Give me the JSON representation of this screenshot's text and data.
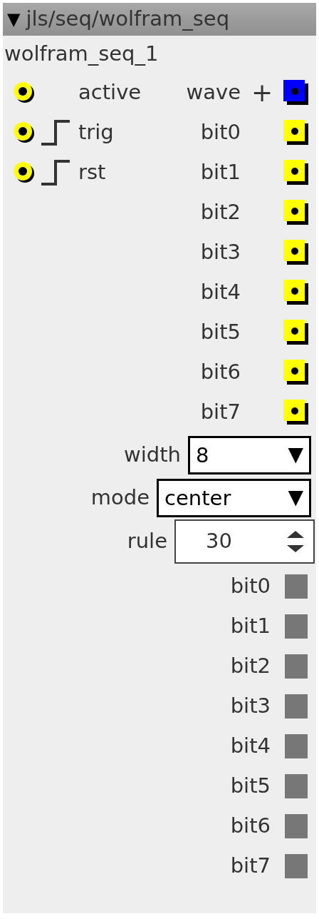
{
  "title_bar": {
    "arrow": "▼",
    "title": "jls/seq/wolfram_seq"
  },
  "node_name": "wolfram_seq_1",
  "inputs": [
    {
      "kind": "value",
      "label": "active"
    },
    {
      "kind": "trigger",
      "label": "trig"
    },
    {
      "kind": "trigger",
      "label": "rst"
    }
  ],
  "outputs": [
    {
      "kind": "wave",
      "label": "wave",
      "add": "+"
    },
    {
      "kind": "bit",
      "label": "bit0"
    },
    {
      "kind": "bit",
      "label": "bit1"
    },
    {
      "kind": "bit",
      "label": "bit2"
    },
    {
      "kind": "bit",
      "label": "bit3"
    },
    {
      "kind": "bit",
      "label": "bit4"
    },
    {
      "kind": "bit",
      "label": "bit5"
    },
    {
      "kind": "bit",
      "label": "bit6"
    },
    {
      "kind": "bit",
      "label": "bit7"
    }
  ],
  "params": [
    {
      "kind": "select",
      "label": "width",
      "value": "8",
      "arrow": "▼"
    },
    {
      "kind": "select",
      "label": "mode",
      "value": "center",
      "arrow": "▼"
    },
    {
      "kind": "number",
      "label": "rule",
      "value": "30"
    }
  ],
  "bit_displays": [
    {
      "label": "bit0"
    },
    {
      "label": "bit1"
    },
    {
      "label": "bit2"
    },
    {
      "label": "bit3"
    },
    {
      "label": "bit4"
    },
    {
      "label": "bit5"
    },
    {
      "label": "bit6"
    },
    {
      "label": "bit7"
    }
  ]
}
